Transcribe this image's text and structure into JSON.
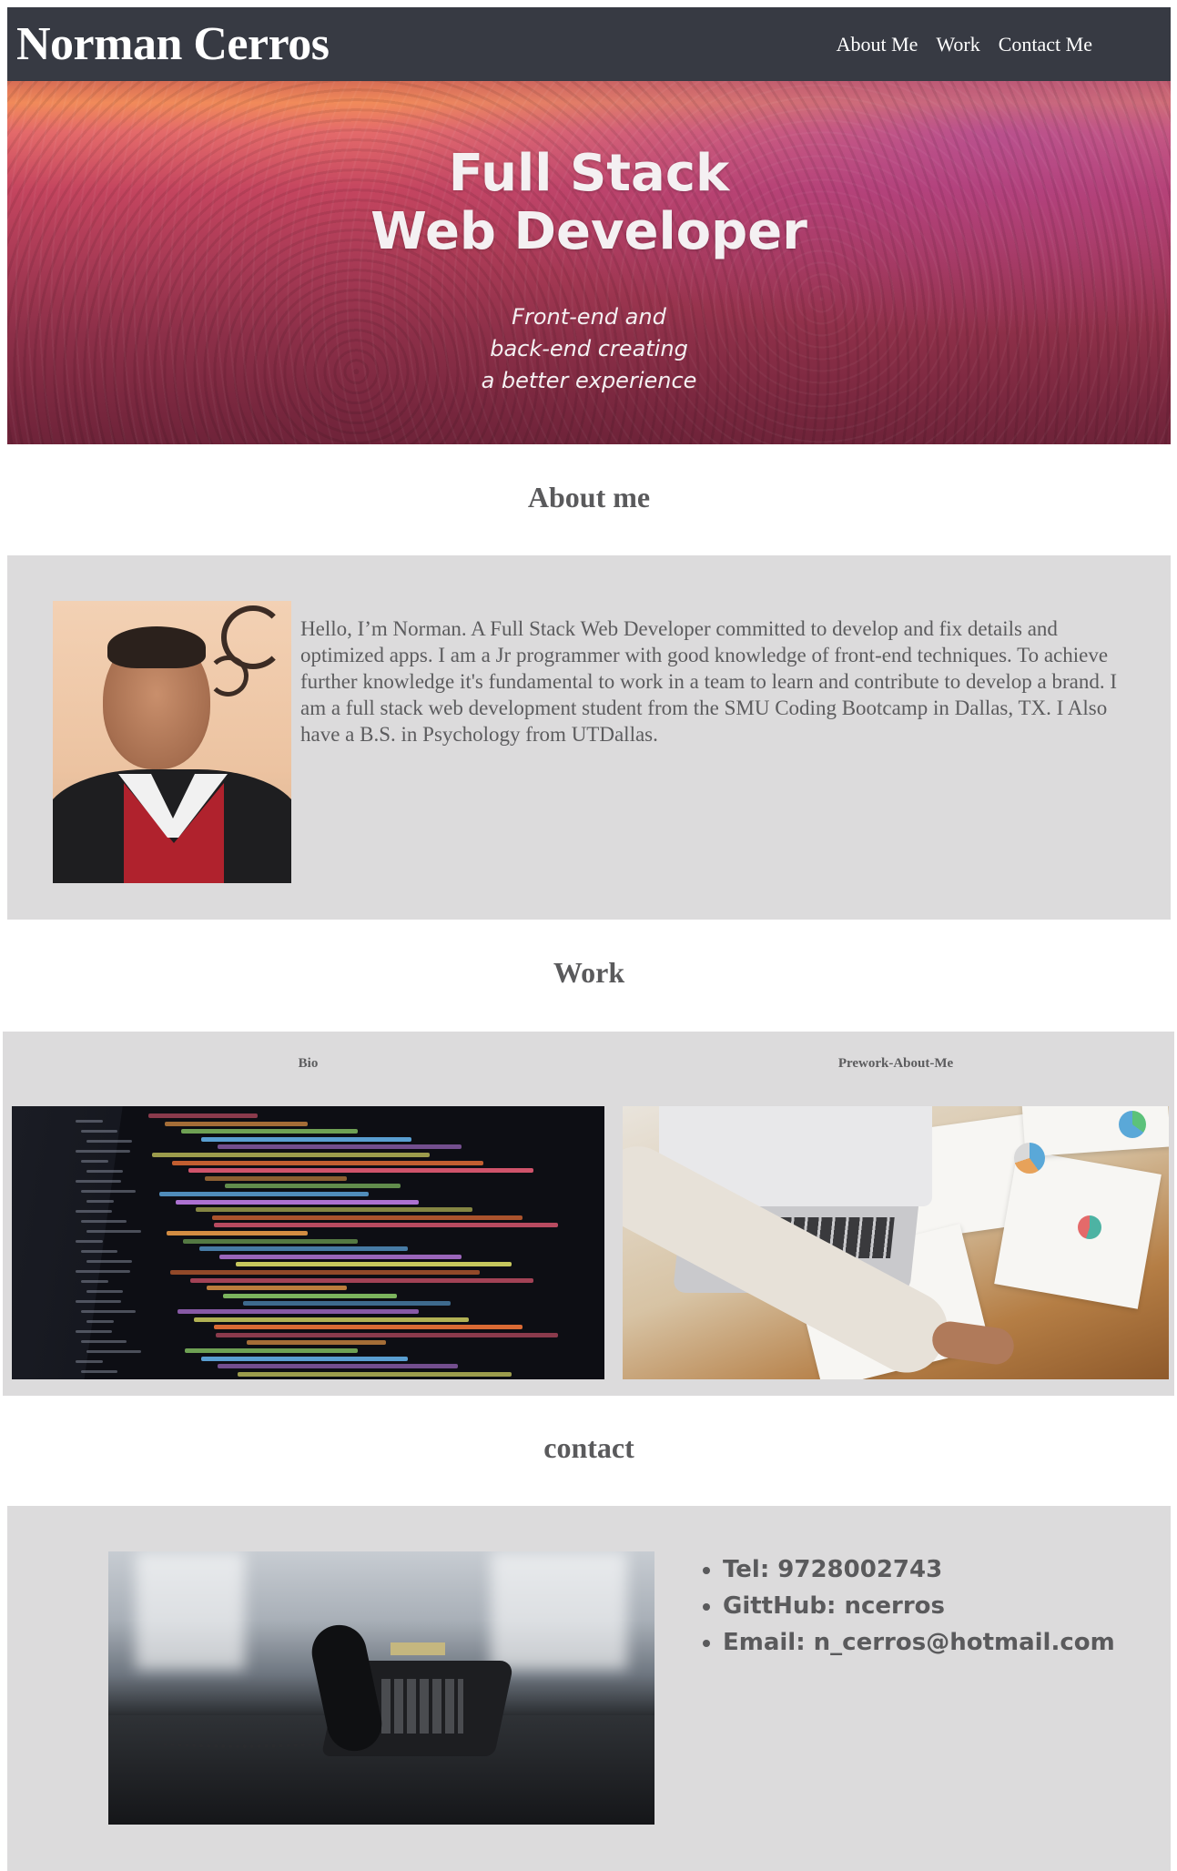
{
  "header": {
    "brand": "Norman Cerros",
    "nav": [
      {
        "label": "About Me"
      },
      {
        "label": "Work"
      },
      {
        "label": "Contact Me"
      }
    ]
  },
  "hero": {
    "title": "Full Stack\nWeb Developer",
    "subtitle": "Front-end and\nback-end creating\na better experience"
  },
  "about": {
    "heading": "About me",
    "bio": "Hello, I’m Norman. A Full Stack Web Developer committed to develop and fix details and optimized apps. I am a Jr programmer with good knowledge of front-end techniques. To achieve further knowledge it's fundamental to work in a team to learn and contribute to develop a brand. I am a full stack web development student from the SMU Coding Bootcamp in Dallas, TX. I Also have a B.S. in Psychology from UTDallas."
  },
  "work": {
    "heading": "Work",
    "projects": [
      {
        "title": "Bio",
        "image_icon": "code-screen-image"
      },
      {
        "title": "Prework-About-Me",
        "image_icon": "laptop-desk-image"
      }
    ]
  },
  "contact": {
    "heading": "contact",
    "items": [
      "Tel: 9728002743",
      "GittHub: ncerros",
      "Email: n_cerros@hotmail.com"
    ]
  },
  "colors": {
    "header_bg": "#373a43",
    "section_bg": "#dcdbdc",
    "text": "#5a5a5c"
  }
}
